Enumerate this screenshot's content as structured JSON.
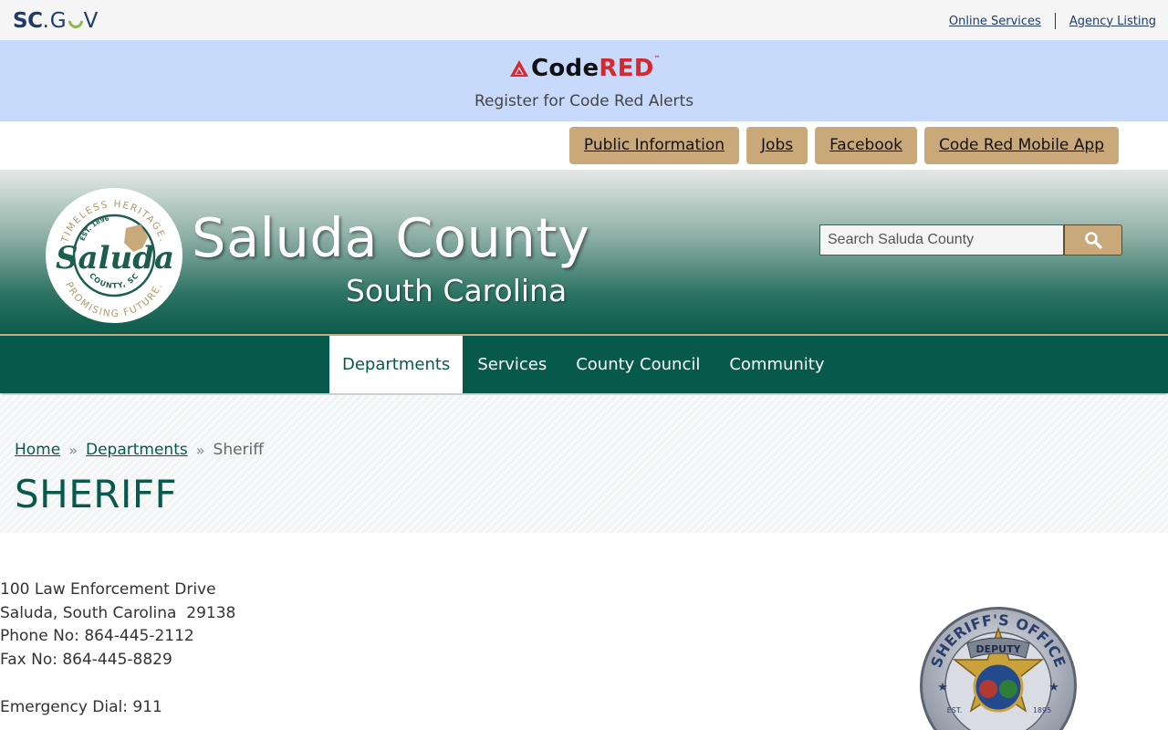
{
  "scgov": {
    "logo_sc": "SC",
    "logo_dot": ".",
    "logo_g": "G",
    "logo_v": "V",
    "links": [
      {
        "label": "Online Services"
      },
      {
        "label": "Agency Listing"
      }
    ]
  },
  "codered": {
    "brand_code": "Code",
    "brand_red": "RED",
    "tm": "™",
    "tagline": "Register for Code Red Alerts"
  },
  "quick_links": [
    {
      "label": "Public Information"
    },
    {
      "label": "Jobs"
    },
    {
      "label": "Facebook"
    },
    {
      "label": "Code Red Mobile App"
    }
  ],
  "header": {
    "title": "Saluda County",
    "subtitle": "South Carolina",
    "seal": {
      "top_arc": "TIMELESS HERITAGE.",
      "bottom_arc": "PROMISING FUTURE.",
      "est": "EST. 1896",
      "script": "Saluda",
      "county": "COUNTY, SC"
    },
    "search_placeholder": "Search Saluda County",
    "search_icon": "magnifier-icon"
  },
  "nav": {
    "items": [
      {
        "label": "Departments",
        "active": true
      },
      {
        "label": "Services"
      },
      {
        "label": "County Council"
      },
      {
        "label": "Community"
      }
    ]
  },
  "breadcrumb": {
    "home": "Home",
    "departments": "Departments",
    "current": "Sheriff",
    "separator": "»"
  },
  "page": {
    "title": "SHERIFF"
  },
  "contact": {
    "address1": "100 Law Enforcement Drive",
    "address2": "Saluda, South Carolina  29138",
    "phone": "Phone No: 864-445-2112",
    "fax": "Fax No: 864-445-8829",
    "emergency": "Emergency Dial: 911"
  },
  "badge": {
    "top_arc": "SHERIFF'S OFFICE",
    "ribbon": "DEPUTY",
    "est_left": "EST.",
    "est_right": "1895"
  },
  "colors": {
    "brand_green": "#07594c",
    "accent_gold": "#c9a97a",
    "codered_bg": "#c8dafc",
    "codered_red": "#d9272e"
  }
}
